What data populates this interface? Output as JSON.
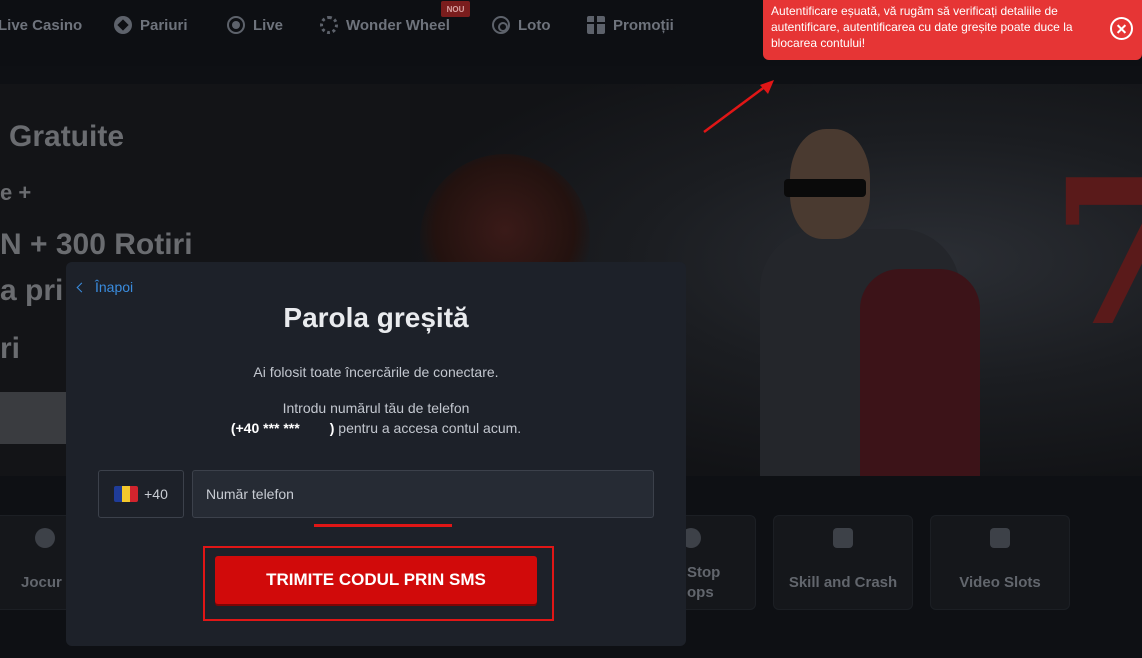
{
  "nav": {
    "items": [
      {
        "label": "Live Casino",
        "icon": "none"
      },
      {
        "label": "Pariuri",
        "icon": "ball-icon"
      },
      {
        "label": "Live",
        "icon": "live-icon"
      },
      {
        "label": "Wonder Wheel",
        "icon": "wheel-icon",
        "badge": "NOU"
      },
      {
        "label": "Loto",
        "icon": "loto-icon"
      },
      {
        "label": "Promoții",
        "icon": "gift-icon"
      }
    ]
  },
  "banner": {
    "line1": "Gratuite",
    "line2": "e +",
    "line3": "N + 300 Rotiri",
    "line4": "a pri",
    "line5": "ri"
  },
  "categories": [
    {
      "label": "Jocur"
    },
    {
      "label": "Stop",
      "label2": "ops"
    },
    {
      "label": "Skill and Crash"
    },
    {
      "label": "Video Slots"
    }
  ],
  "modal": {
    "back": "Înapoi",
    "title": "Parola greșită",
    "subtitle": "Ai folosit toate încercările de conectare.",
    "instruction": "Introdu numărul tău de telefon",
    "phone_masked": "(+40 *** ***",
    "phone_suffix": ")",
    "instruction_end": "pentru a accesa contul acum.",
    "country_code": "+40",
    "phone_placeholder": "Număr telefon",
    "button": "TRIMITE CODUL PRIN SMS"
  },
  "toast": {
    "message": "Autentificare eșuată, vă rugăm să verificați detaliile de autentificare, autentificarea cu date greșite poate duce la blocarea contului!"
  },
  "colors": {
    "accent_red": "#d10a0a",
    "toast_red": "#e63535",
    "link_blue": "#3a8cde",
    "modal_bg": "#1d2129"
  }
}
